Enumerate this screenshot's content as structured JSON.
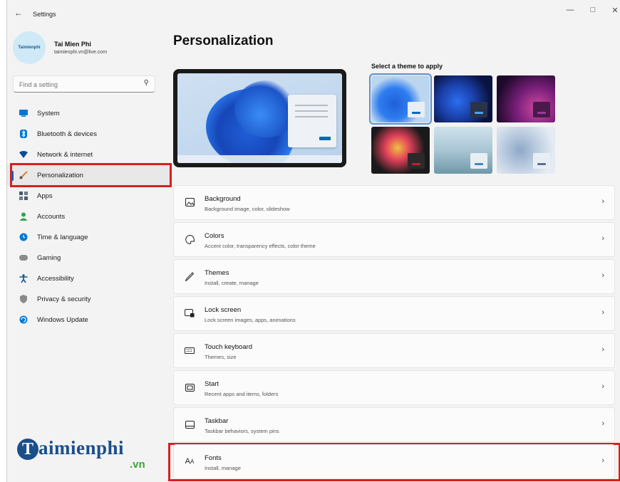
{
  "titlebar": {
    "back_icon": "arrow-left-icon",
    "title": "Settings",
    "minimize": "—",
    "maximize": "□",
    "close": "✕"
  },
  "profile": {
    "avatar_text": "Taimienphi",
    "name": "Tai Mien Phi",
    "email": "taimienphi.vn@live.com"
  },
  "search": {
    "placeholder": "Find a setting",
    "icon": "search-icon"
  },
  "nav": {
    "items": [
      {
        "label": "System",
        "icon": "monitor-icon",
        "color": "#0078d4"
      },
      {
        "label": "Bluetooth & devices",
        "icon": "bluetooth-icon",
        "color": "#0078d4"
      },
      {
        "label": "Network & internet",
        "icon": "wifi-icon",
        "color": "#0a4c9a"
      },
      {
        "label": "Personalization",
        "icon": "brush-icon",
        "color": "#d9822b",
        "active": true
      },
      {
        "label": "Apps",
        "icon": "apps-icon",
        "color": "#4a5a6a"
      },
      {
        "label": "Accounts",
        "icon": "person-icon",
        "color": "#2ea44f"
      },
      {
        "label": "Time & language",
        "icon": "globe-clock-icon",
        "color": "#0078d4"
      },
      {
        "label": "Gaming",
        "icon": "gamepad-icon",
        "color": "#7a7a7a"
      },
      {
        "label": "Accessibility",
        "icon": "accessibility-icon",
        "color": "#1b4f8a"
      },
      {
        "label": "Privacy & security",
        "icon": "shield-icon",
        "color": "#7a7a7a"
      },
      {
        "label": "Windows Update",
        "icon": "update-icon",
        "color": "#0078d4"
      }
    ]
  },
  "brand": {
    "letter": "T",
    "name": "aimienphi",
    "tld": ".vn"
  },
  "main": {
    "title": "Personalization",
    "themes_label": "Select a theme to apply",
    "cards": [
      {
        "title": "Background",
        "subtitle": "Background image, color, slideshow",
        "icon": "image-icon"
      },
      {
        "title": "Colors",
        "subtitle": "Accent color, transparency effects, color theme",
        "icon": "palette-icon"
      },
      {
        "title": "Themes",
        "subtitle": "Install, create, manage",
        "icon": "pen-icon"
      },
      {
        "title": "Lock screen",
        "subtitle": "Lock screen images, apps, animations",
        "icon": "lock-screen-icon"
      },
      {
        "title": "Touch keyboard",
        "subtitle": "Themes, size",
        "icon": "keyboard-icon"
      },
      {
        "title": "Start",
        "subtitle": "Recent apps and items, folders",
        "icon": "start-icon"
      },
      {
        "title": "Taskbar",
        "subtitle": "Taskbar behaviors, system pins",
        "icon": "taskbar-icon"
      },
      {
        "title": "Fonts",
        "subtitle": "Install, manage",
        "icon": "fonts-icon"
      }
    ],
    "chevron": "›"
  },
  "colors": {
    "accent": "#005fb8",
    "highlight_box": "#d62020"
  }
}
